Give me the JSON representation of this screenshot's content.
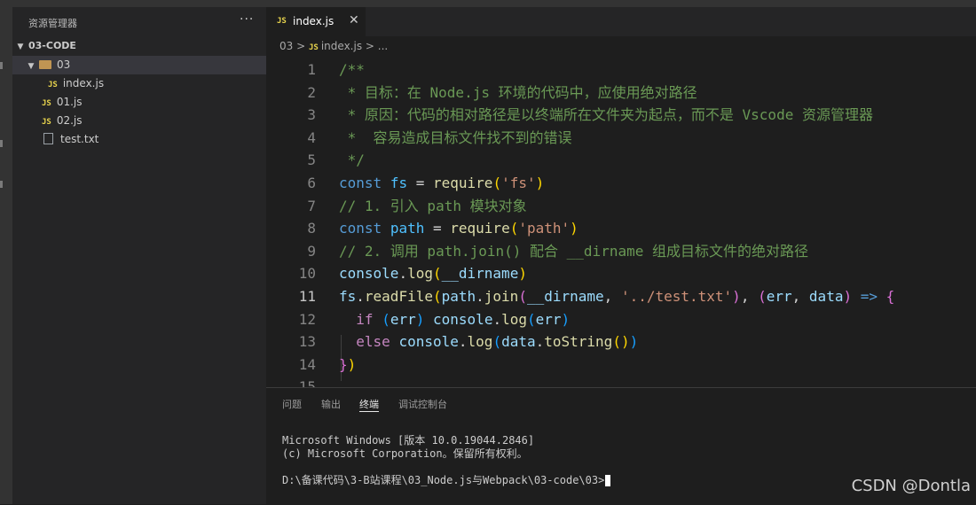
{
  "sidebar": {
    "title": "资源管理器",
    "more": "···",
    "root": "03-CODE",
    "folder": "03",
    "items": [
      {
        "name": "index.js",
        "type": "js"
      },
      {
        "name": "01.js",
        "type": "js"
      },
      {
        "name": "02.js",
        "type": "js"
      },
      {
        "name": "test.txt",
        "type": "txt"
      }
    ]
  },
  "tab": {
    "badge": "JS",
    "label": "index.js",
    "close": "✕"
  },
  "breadcrumb": {
    "folder": "03",
    "sep": ">",
    "badge": "JS",
    "file": "index.js",
    "tail": "..."
  },
  "code": {
    "current_line": 11,
    "lines": [
      {
        "n": "1",
        "text": "/**"
      },
      {
        "n": "2",
        "text": " * 目标：在 Node.js 环境的代码中，应使用绝对路径"
      },
      {
        "n": "3",
        "text": " * 原因：代码的相对路径是以终端所在文件夹为起点，而不是 Vscode 资源管理器"
      },
      {
        "n": "4",
        "text": " *  容易造成目标文件找不到的错误"
      },
      {
        "n": "5",
        "text": " */"
      },
      {
        "n": "6",
        "text": "const fs = require('fs')"
      },
      {
        "n": "7",
        "text": "// 1. 引入 path 模块对象"
      },
      {
        "n": "8",
        "text": "const path = require('path')"
      },
      {
        "n": "9",
        "text": "// 2. 调用 path.join() 配合 __dirname 组成目标文件的绝对路径"
      },
      {
        "n": "10",
        "text": "console.log(__dirname)"
      },
      {
        "n": "11",
        "text": "fs.readFile(path.join(__dirname, '../test.txt'), (err, data) => {"
      },
      {
        "n": "12",
        "text": "  if (err) console.log(err)"
      },
      {
        "n": "13",
        "text": "  else console.log(data.toString())"
      },
      {
        "n": "14",
        "text": "})"
      },
      {
        "n": "15",
        "text": ""
      }
    ]
  },
  "panel": {
    "tabs": [
      "问题",
      "输出",
      "终端",
      "调试控制台"
    ],
    "active_tab": "终端",
    "terminal": [
      "Microsoft Windows [版本 10.0.19044.2846]",
      "(c) Microsoft Corporation。保留所有权利。",
      "",
      "D:\\备课代码\\3-B站课程\\03_Node.js与Webpack\\03-code\\03>"
    ]
  },
  "watermark": "CSDN @Dontla",
  "colors": {
    "background": "#1e1e1e",
    "sidebar": "#252526",
    "comment": "#6a9955",
    "keyword": "#569cd6",
    "string": "#ce9178",
    "function": "#dcdcaa"
  }
}
